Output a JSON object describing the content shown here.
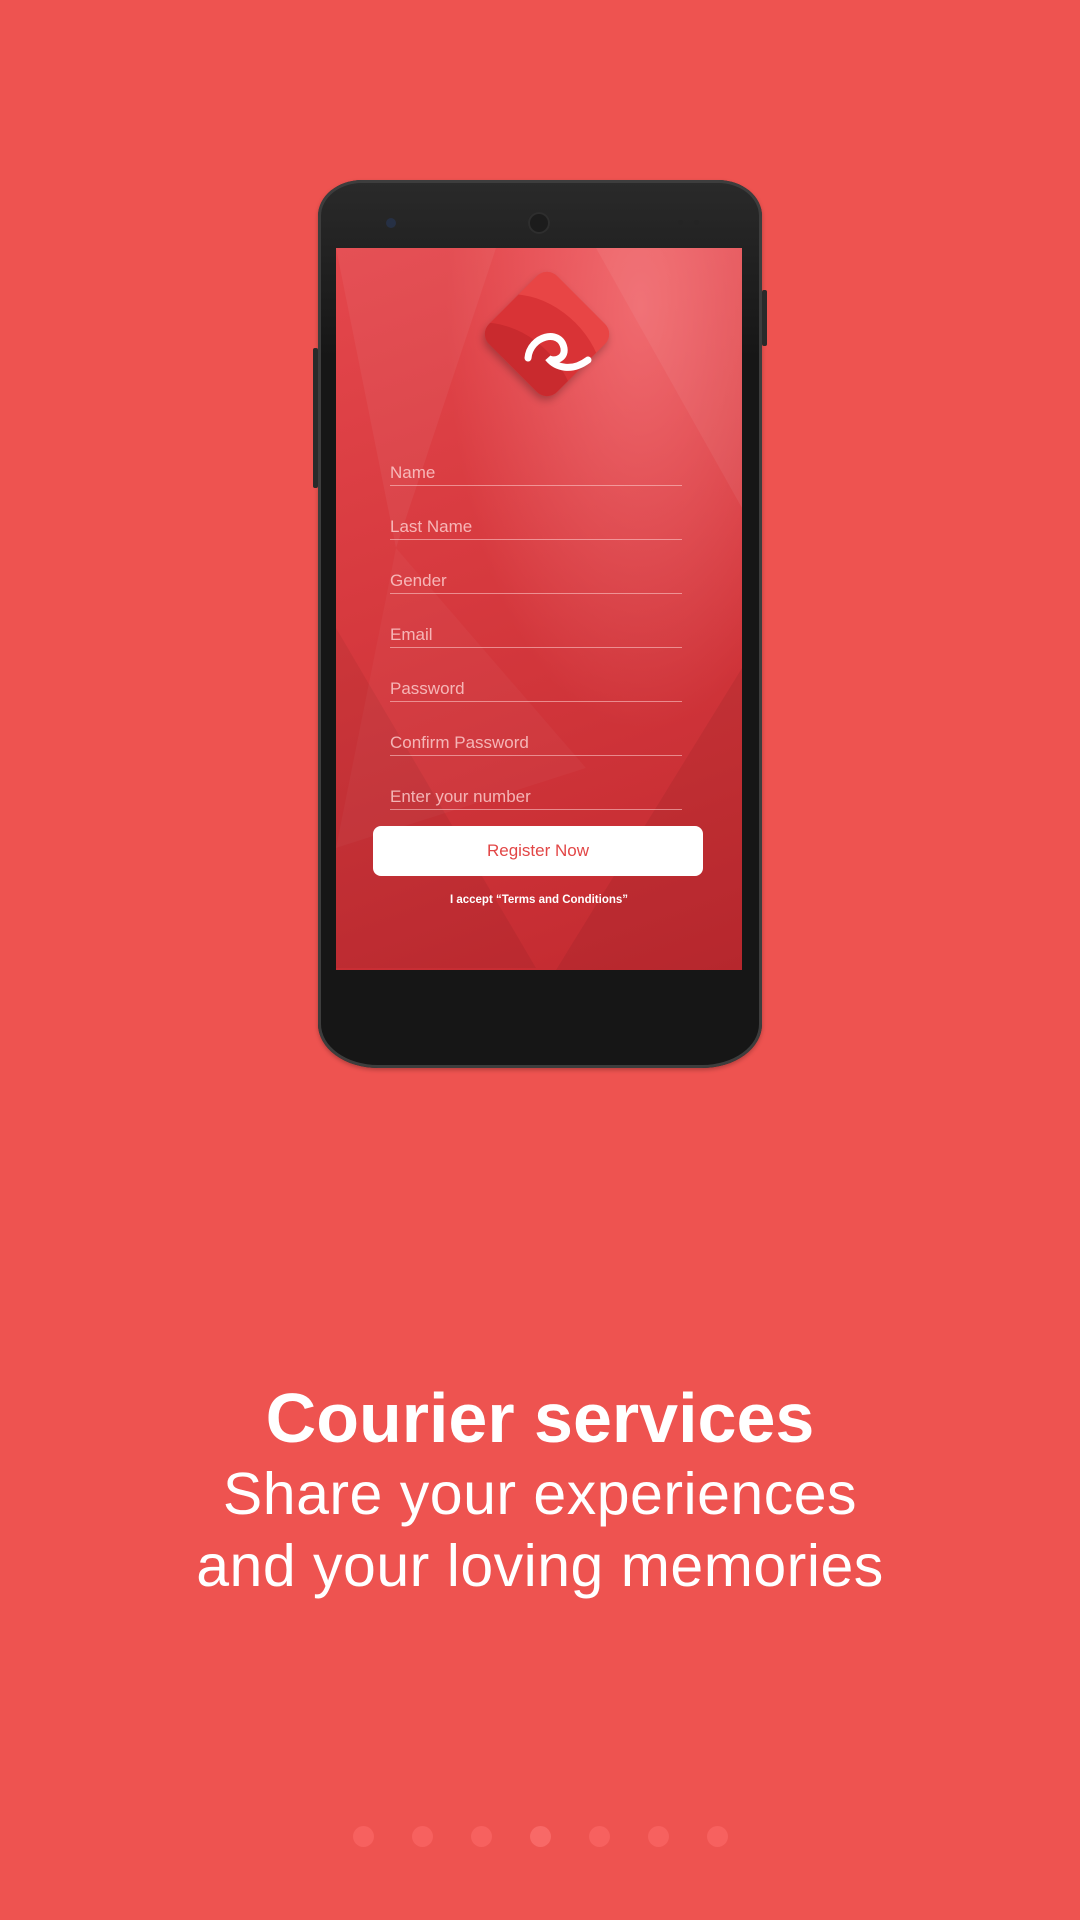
{
  "register_form": {
    "fields": [
      {
        "placeholder": "Name",
        "value": ""
      },
      {
        "placeholder": "Last Name",
        "value": ""
      },
      {
        "placeholder": "Gender",
        "value": ""
      },
      {
        "placeholder": "Email",
        "value": ""
      },
      {
        "placeholder": "Password",
        "value": ""
      },
      {
        "placeholder": "Confirm Password",
        "value": ""
      },
      {
        "placeholder": "Enter your number",
        "value": ""
      }
    ],
    "register_label": "Register Now",
    "terms_text": "I accept “Terms and Conditions”"
  },
  "onboarding": {
    "title": "Courier services",
    "subtitle_line1": "Share your experiences",
    "subtitle_line2": "and your loving memories",
    "page_count": 7,
    "active_page": 4
  },
  "colors": {
    "background": "#ee5350",
    "accent": "#e24646",
    "button_bg": "#ffffff"
  },
  "icons": {
    "logo": "app-logo-icon"
  }
}
